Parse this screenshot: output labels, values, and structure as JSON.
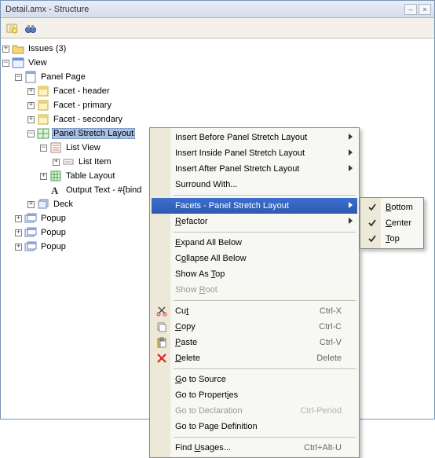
{
  "window": {
    "title": "Detail.amx - Structure"
  },
  "tree": {
    "issues_label": "Issues (3)",
    "view_label": "View",
    "panel_page": "Panel Page",
    "facet_header": "Facet - header",
    "facet_primary": "Facet - primary",
    "facet_secondary": "Facet - secondary",
    "panel_stretch": "Panel Stretch Layout",
    "list_view": "List View",
    "list_item": "List Item",
    "table_layout": "Table Layout",
    "output_text": "Output Text - #{bind",
    "deck": "Deck",
    "popup1": "Popup",
    "popup2": "Popup",
    "popup3": "Popup"
  },
  "menu": {
    "insert_before": "Insert Before Panel Stretch Layout",
    "insert_inside": "Insert Inside Panel Stretch Layout",
    "insert_after": "Insert After Panel Stretch Layout",
    "surround": "Surround With...",
    "facets": "Facets - Panel Stretch Layout",
    "refactor": "Refactor",
    "expand_all": "Expand All Below",
    "collapse_all": "Collapse All Below",
    "show_as_top": "Show As Top",
    "show_root": "Show Root",
    "cut": "Cut",
    "cut_key": "Ctrl-X",
    "copy": "Copy",
    "copy_key": "Ctrl-C",
    "paste": "Paste",
    "paste_key": "Ctrl-V",
    "delete": "Delete",
    "delete_key": "Delete",
    "go_source": "Go to Source",
    "go_props": "Go to Properties",
    "go_decl": "Go to Declaration",
    "go_decl_key": "Ctrl-Period",
    "go_pagedef": "Go to Page Definition",
    "find_usages": "Find Usages...",
    "find_key": "Ctrl+Alt-U"
  },
  "submenu": {
    "bottom": "Bottom",
    "center": "Center",
    "top": "Top"
  }
}
